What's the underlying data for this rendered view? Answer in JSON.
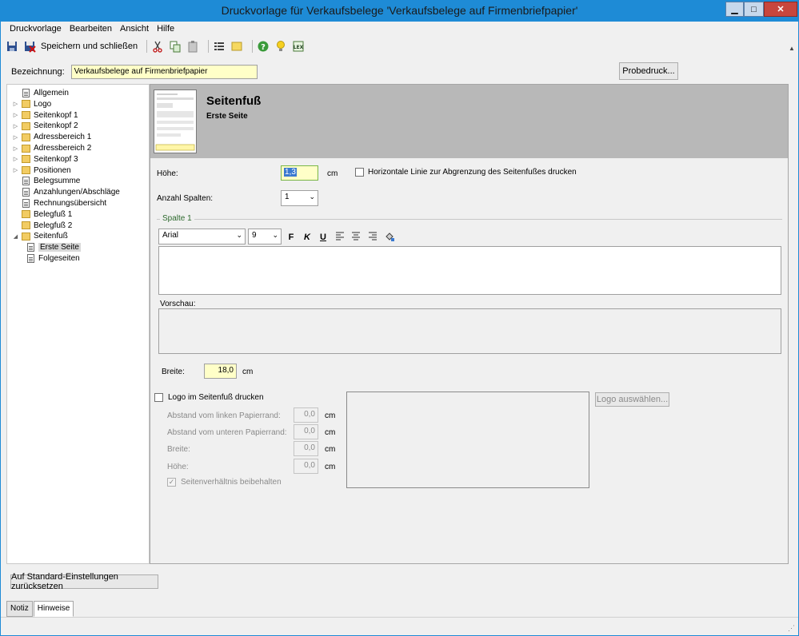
{
  "window": {
    "title": "Druckvorlage für Verkaufsbelege 'Verkaufsbelege auf Firmenbriefpapier'",
    "controls": [
      "minimize",
      "maximize",
      "close"
    ]
  },
  "menu": [
    "Druckvorlage",
    "Bearbeiten",
    "Ansicht",
    "Hilfe"
  ],
  "toolbar": {
    "save_close_label": "Speichern und schließen"
  },
  "bezeichnung": {
    "label": "Bezeichnung:",
    "value": "Verkaufsbelege auf Firmenbriefpapier"
  },
  "probedruck_label": "Probedruck...",
  "tree": [
    {
      "label": "Allgemein",
      "type": "page",
      "level": 0,
      "expandable": false
    },
    {
      "label": "Logo",
      "type": "folder",
      "level": 0,
      "expandable": true
    },
    {
      "label": "Seitenkopf 1",
      "type": "folder",
      "level": 0,
      "expandable": true
    },
    {
      "label": "Seitenkopf 2",
      "type": "folder",
      "level": 0,
      "expandable": true
    },
    {
      "label": "Adressbereich 1",
      "type": "folder",
      "level": 0,
      "expandable": true
    },
    {
      "label": "Adressbereich 2",
      "type": "folder",
      "level": 0,
      "expandable": true
    },
    {
      "label": "Seitenkopf 3",
      "type": "folder",
      "level": 0,
      "expandable": true
    },
    {
      "label": "Positionen",
      "type": "folder",
      "level": 0,
      "expandable": true
    },
    {
      "label": "Belegsumme",
      "type": "page",
      "level": 0,
      "expandable": false
    },
    {
      "label": "Anzahlungen/Abschläge",
      "type": "page",
      "level": 0,
      "expandable": false
    },
    {
      "label": "Rechnungsübersicht",
      "type": "page",
      "level": 0,
      "expandable": false
    },
    {
      "label": "Belegfuß 1",
      "type": "folder",
      "level": 0,
      "expandable": false
    },
    {
      "label": "Belegfuß 2",
      "type": "folder",
      "level": 0,
      "expandable": false
    },
    {
      "label": "Seitenfuß",
      "type": "folder",
      "level": 0,
      "expandable": true,
      "expanded": true
    },
    {
      "label": "Erste Seite",
      "type": "page",
      "level": 1,
      "expandable": false,
      "selected": true
    },
    {
      "label": "Folgeseiten",
      "type": "page",
      "level": 1,
      "expandable": false
    }
  ],
  "header": {
    "title": "Seitenfuß",
    "subtitle": "Erste Seite"
  },
  "hoehe": {
    "label": "Höhe:",
    "value": "1,3",
    "unit": "cm"
  },
  "horizontal_line": {
    "label": "Horizontale Linie zur Abgrenzung des Seitenfußes drucken",
    "checked": false
  },
  "anzahl_spalten": {
    "label": "Anzahl Spalten:",
    "value": "1"
  },
  "spalte": {
    "group_label": "Spalte 1",
    "font": "Arial",
    "size": "9"
  },
  "format_buttons": [
    "F",
    "K",
    "U"
  ],
  "vorschau_label": "Vorschau:",
  "breite": {
    "label": "Breite:",
    "value": "18,0",
    "unit": "cm"
  },
  "logo": {
    "print_label": "Logo im Seitenfuß drucken",
    "checked": false,
    "choose_label": "Logo auswählen...",
    "fields": [
      {
        "label": "Abstand vom linken Papierrand:",
        "value": "0,0",
        "unit": "cm"
      },
      {
        "label": "Abstand vom unteren Papierrand:",
        "value": "0,0",
        "unit": "cm"
      },
      {
        "label": "Breite:",
        "value": "0,0",
        "unit": "cm"
      },
      {
        "label": "Höhe:",
        "value": "0,0",
        "unit": "cm"
      }
    ],
    "aspect_label": "Seitenverhältnis beibehalten",
    "aspect_checked": true
  },
  "reset_label": "Auf Standard-Einstellungen zurücksetzen",
  "tabs": [
    {
      "label": "Notiz",
      "active": false
    },
    {
      "label": "Hinweise",
      "active": true
    }
  ],
  "colors": {
    "titlebar": "#1e8bd6",
    "input_highlight": "#ffffc8",
    "header_band": "#b8b8b8"
  }
}
